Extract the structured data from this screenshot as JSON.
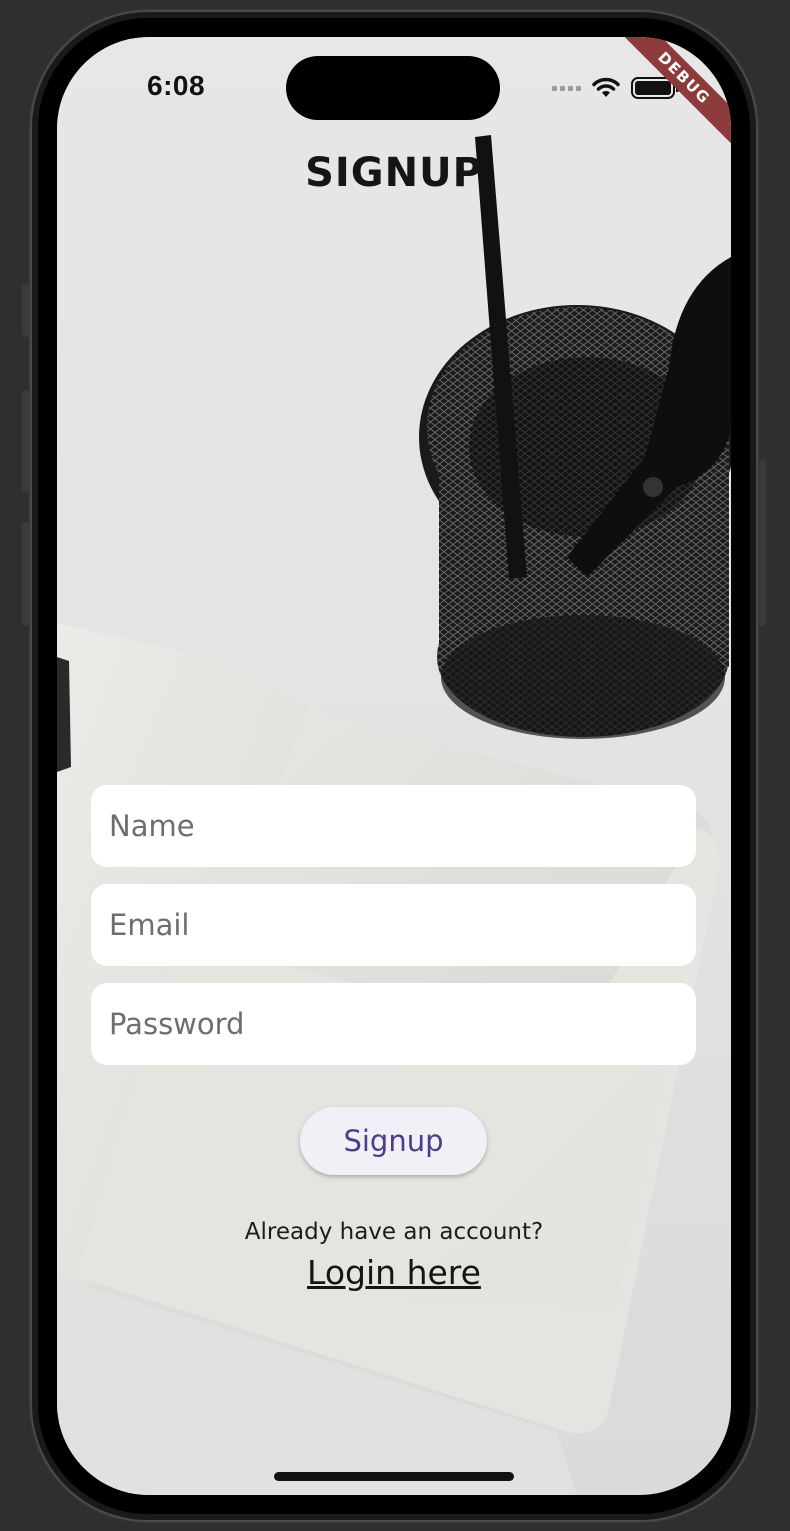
{
  "status_bar": {
    "time": "6:08",
    "icons": [
      "cellular-dots-icon",
      "wifi-icon",
      "battery-icon"
    ]
  },
  "debug_banner": "DEBUG",
  "page": {
    "title": "SIGNUP"
  },
  "form": {
    "name_placeholder": "Name",
    "email_placeholder": "Email",
    "password_placeholder": "Password",
    "submit_label": "Signup",
    "submit_text_color": "#4b3f8c",
    "submit_background": "#f2eff7"
  },
  "footer": {
    "prompt": "Already have an account?",
    "login_link": "Login here"
  }
}
